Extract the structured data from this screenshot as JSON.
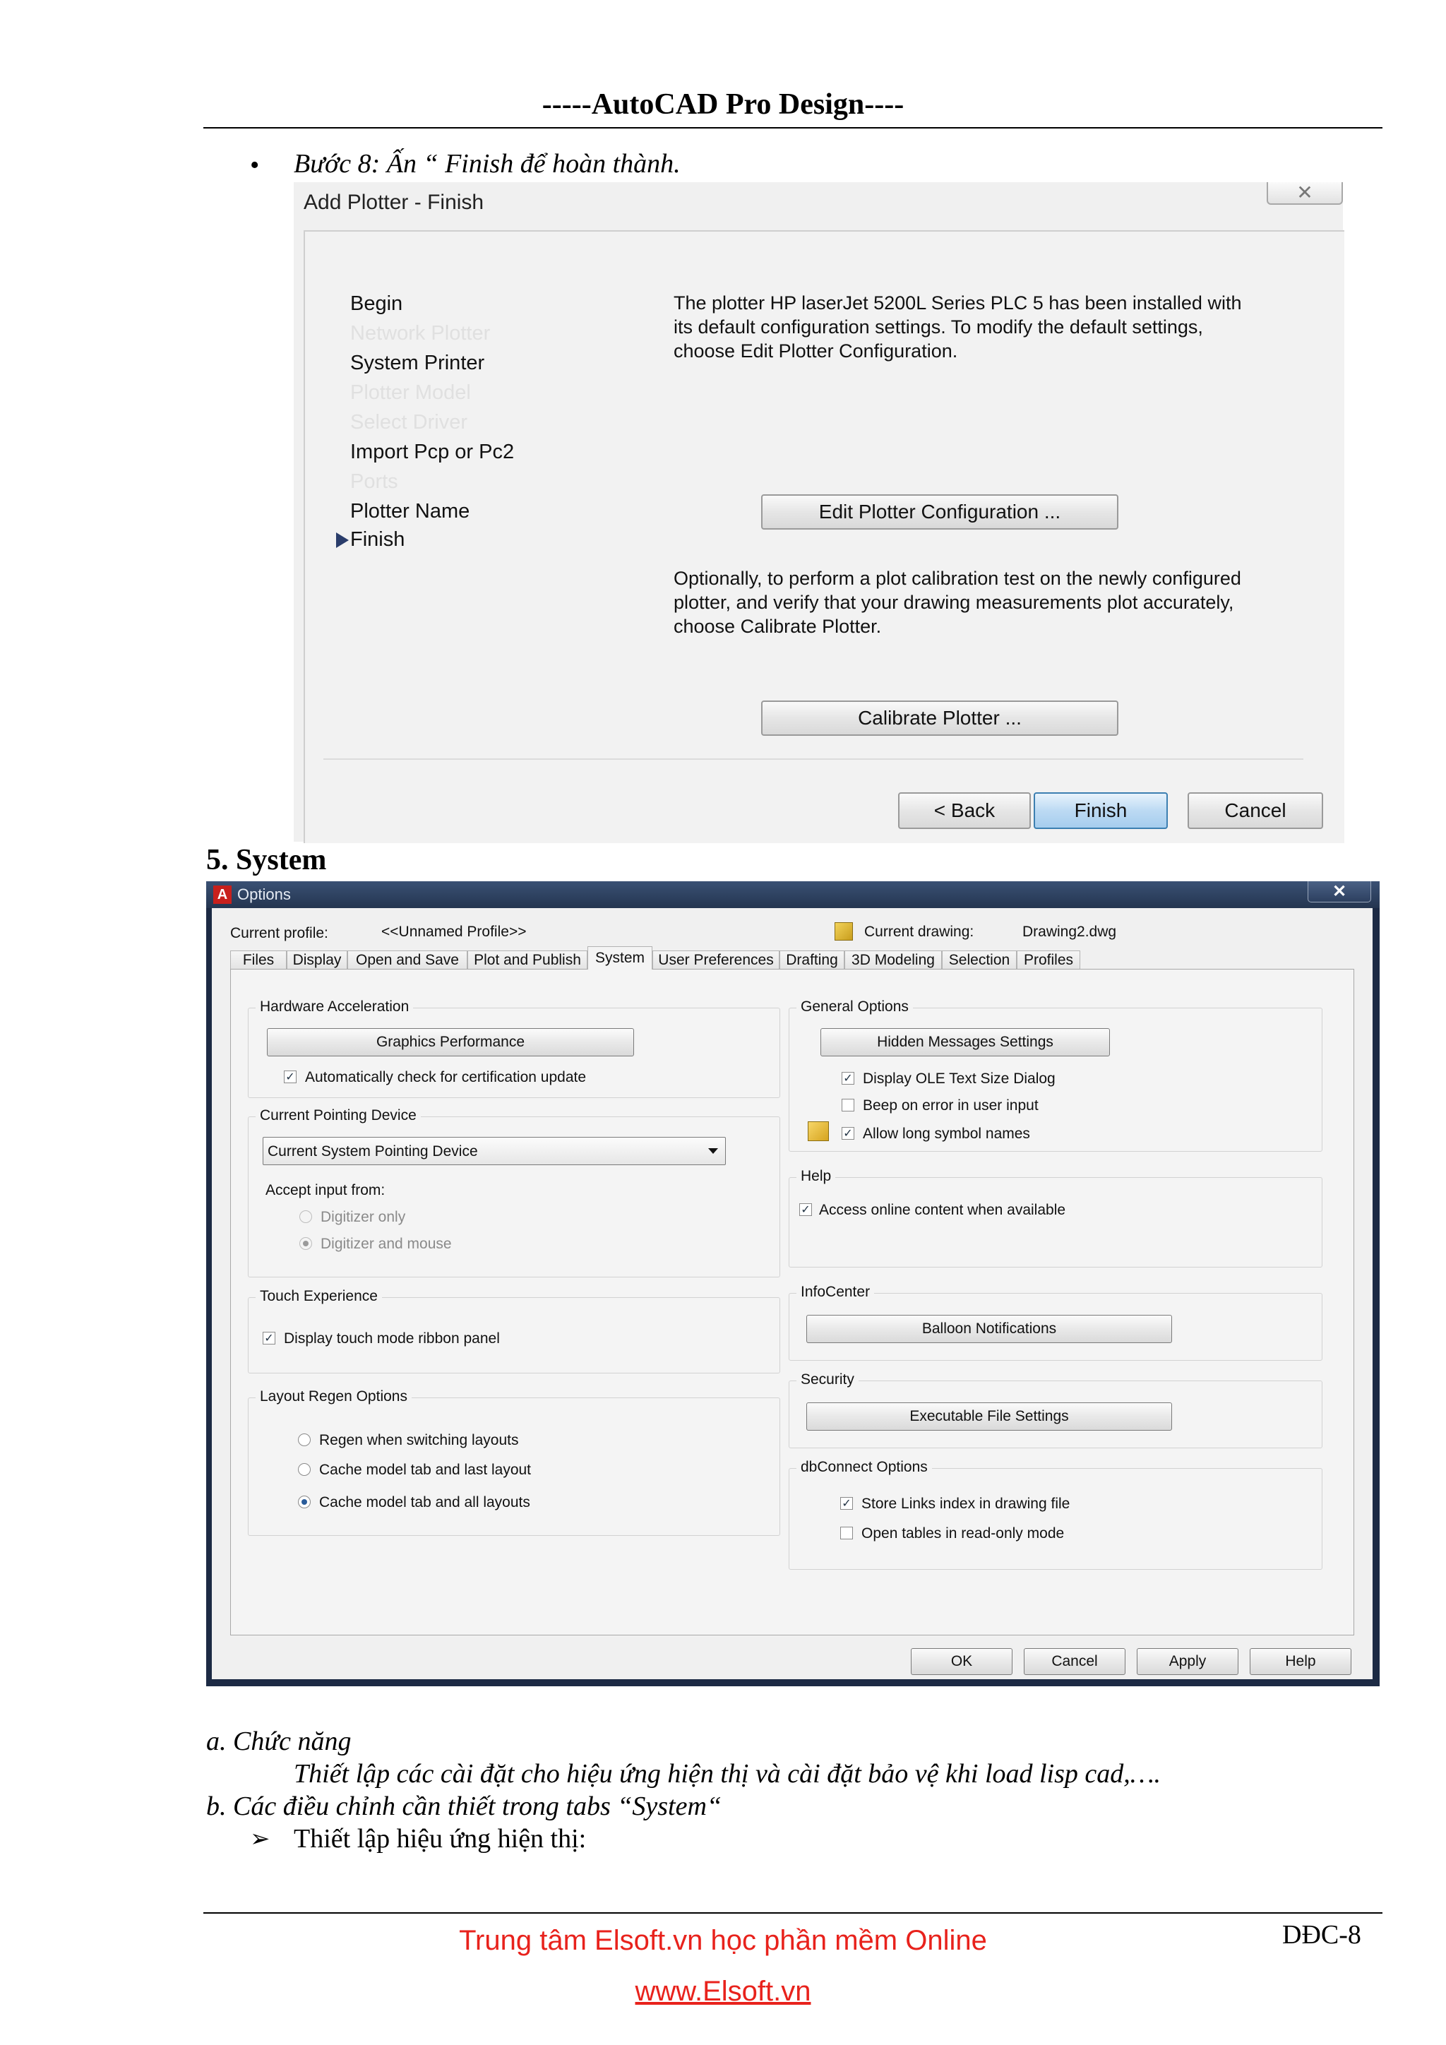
{
  "header": {
    "title": "-----AutoCAD Pro Design----"
  },
  "step8": {
    "bullet": "•",
    "text": "Bước 8: Ấn “ Finish để hoàn thành."
  },
  "add_plotter": {
    "title": "Add Plotter - Finish",
    "steps": [
      {
        "label": "Begin",
        "dim": false
      },
      {
        "label": "Network Plotter",
        "dim": true
      },
      {
        "label": "System Printer",
        "dim": false
      },
      {
        "label": "Plotter Model",
        "dim": true
      },
      {
        "label": "Select Driver",
        "dim": true
      },
      {
        "label": "Import Pcp or Pc2",
        "dim": false
      },
      {
        "label": "Ports",
        "dim": true
      },
      {
        "label": "Plotter Name",
        "dim": false
      },
      {
        "label": "Finish",
        "dim": false
      }
    ],
    "message1": "The plotter HP laserJet 5200L Series PLC 5 has been installed with its default configuration settings.  To modify the default settings, choose Edit Plotter Configuration.",
    "edit_button": "Edit Plotter Configuration ...",
    "message2": "Optionally, to perform a plot calibration test on the newly configured plotter, and verify that your drawing measurements plot accurately, choose Calibrate Plotter.",
    "calibrate_button": "Calibrate Plotter ...",
    "back_button": "< Back",
    "finish_button": "Finish",
    "cancel_button": "Cancel"
  },
  "section5": {
    "heading": "5. System"
  },
  "options": {
    "title": "Options",
    "current_profile_label": "Current profile:",
    "current_profile_value": "<<Unnamed Profile>>",
    "current_drawing_label": "Current drawing:",
    "current_drawing_value": "Drawing2.dwg",
    "tabs": [
      "Files",
      "Display",
      "Open and Save",
      "Plot and Publish",
      "System",
      "User Preferences",
      "Drafting",
      "3D Modeling",
      "Selection",
      "Profiles"
    ],
    "hardware": {
      "title": "Hardware Acceleration",
      "button": "Graphics Performance",
      "auto_check": "Automatically check for certification update"
    },
    "pointing": {
      "title": "Current Pointing Device",
      "select": "Current System Pointing Device",
      "accept_label": "Accept input from:",
      "digitizer_only": "Digitizer only",
      "digitizer_mouse": "Digitizer and mouse"
    },
    "touch": {
      "title": "Touch Experience",
      "option": "Display touch mode ribbon panel"
    },
    "layout": {
      "title": "Layout Regen Options",
      "opt1": "Regen when switching layouts",
      "opt2": "Cache model tab and last layout",
      "opt3": "Cache model tab and all layouts"
    },
    "general": {
      "title": "General Options",
      "button": "Hidden Messages Settings",
      "ole": "Display OLE Text Size Dialog",
      "beep": "Beep on error in user input",
      "long_names": "Allow long symbol names"
    },
    "help": {
      "title": "Help",
      "option": "Access online content when available"
    },
    "infocenter": {
      "title": "InfoCenter",
      "button": "Balloon Notifications"
    },
    "security": {
      "title": "Security",
      "button": "Executable File Settings"
    },
    "dbconnect": {
      "title": "dbConnect Options",
      "store_links": "Store Links index in drawing file",
      "read_only": "Open tables in read-only mode"
    },
    "buttons": {
      "ok": "OK",
      "cancel": "Cancel",
      "apply": "Apply",
      "help": "Help"
    }
  },
  "body": {
    "a_heading": "a. Chức năng",
    "a_text": "Thiết lập các cài đặt cho hiệu ứng hiện thị và cài đặt bảo vệ khi load lisp cad,….",
    "b_heading": "b. Các điều chỉnh cần thiết trong tabs “System“",
    "arrow": "➢",
    "bullet_text": "Thiết lập hiệu ứng hiện thị:"
  },
  "footer": {
    "center_line1": "Trung tâm Elsoft.vn học phần mềm Online",
    "center_line2": "www.Elsoft.vn",
    "page_code": "DĐC-8"
  },
  "colors": {
    "footer_text": "#e8221c",
    "dialog_frame": "#1c2a44"
  }
}
